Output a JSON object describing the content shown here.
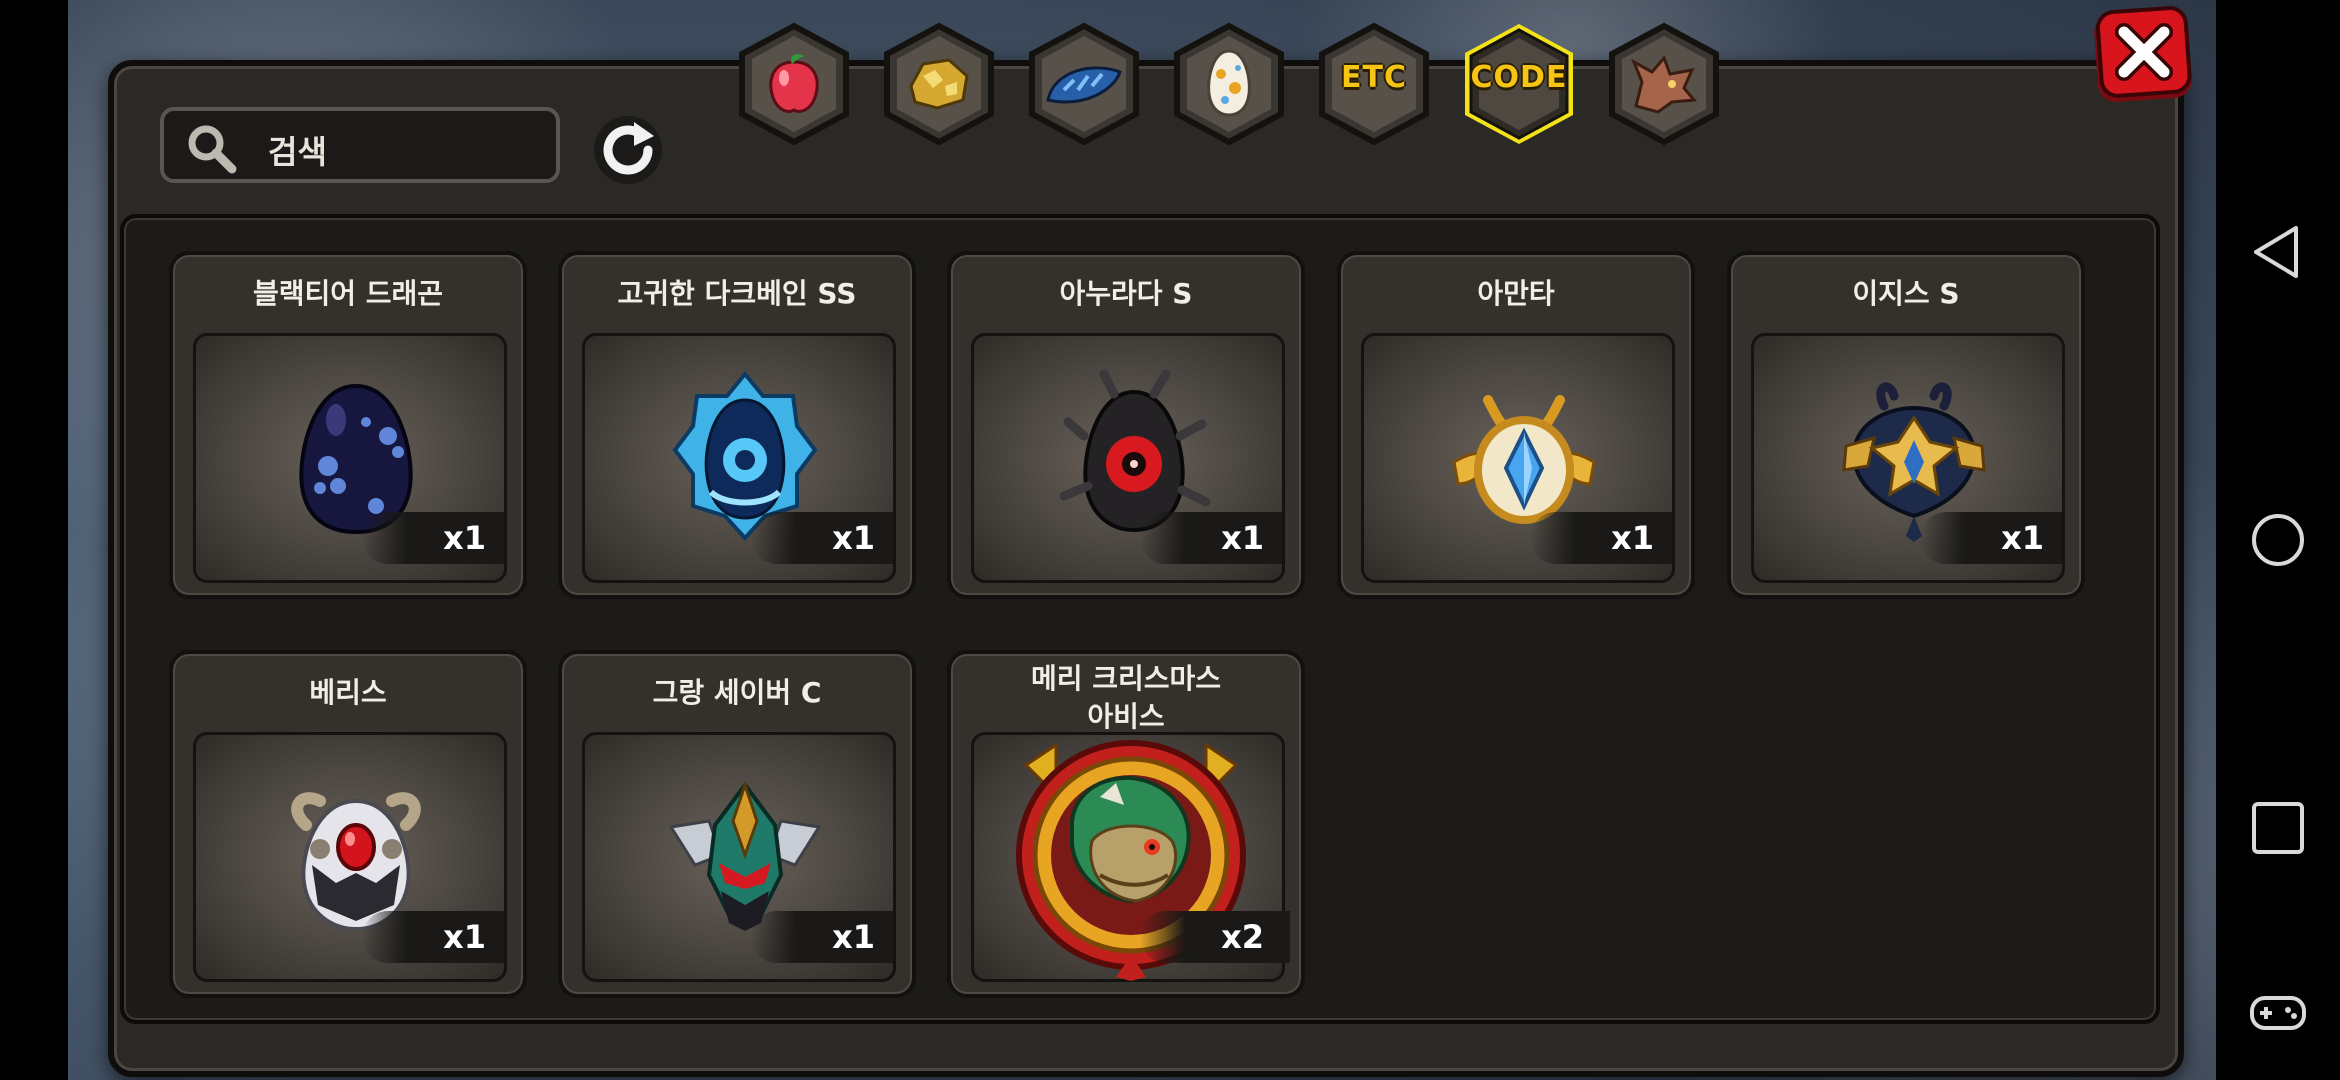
{
  "search": {
    "placeholder": "검색"
  },
  "tabs": [
    {
      "name": "fruit-tab",
      "label": "",
      "icon": "red-fruit-icon",
      "selected": false
    },
    {
      "name": "ore-tab",
      "label": "",
      "icon": "gold-ore-icon",
      "selected": false
    },
    {
      "name": "scale-tab",
      "label": "",
      "icon": "blue-dragon-scale-icon",
      "selected": false
    },
    {
      "name": "egg-tab",
      "label": "",
      "icon": "spotted-egg-icon",
      "selected": false
    },
    {
      "name": "etc-tab",
      "label": "ETC",
      "icon": "",
      "selected": false
    },
    {
      "name": "code-tab",
      "label": "CODE",
      "icon": "",
      "selected": true
    },
    {
      "name": "dragon-tab",
      "label": "",
      "icon": "dragon-head-icon",
      "selected": false
    }
  ],
  "items": [
    {
      "title": "블랙티어 드래곤",
      "qty": "x1",
      "icon": "black-egg-icon"
    },
    {
      "title": "고귀한 다크베인 SS",
      "qty": "x1",
      "icon": "blue-crystal-egg-icon"
    },
    {
      "title": "아누라다 S",
      "qty": "x1",
      "icon": "dark-red-eye-egg-icon"
    },
    {
      "title": "아만타",
      "qty": "x1",
      "icon": "golden-crystal-emblem-icon"
    },
    {
      "title": "이지스 S",
      "qty": "x1",
      "icon": "dark-gold-crest-icon"
    },
    {
      "title": "베리스",
      "qty": "x1",
      "icon": "horned-ruby-egg-icon"
    },
    {
      "title": "그랑 세이버 C",
      "qty": "x1",
      "icon": "green-armor-helmet-icon"
    },
    {
      "title": "메리 크리스마스\n아비스",
      "qty": "x2",
      "icon": "dragon-portrait-medal-icon"
    }
  ],
  "colors": {
    "accent": "#f6c514",
    "panel": "#2b2925",
    "close": "#d8141c"
  },
  "navbar": [
    "back-icon",
    "home-icon",
    "recents-icon",
    "gamepad-icon"
  ]
}
